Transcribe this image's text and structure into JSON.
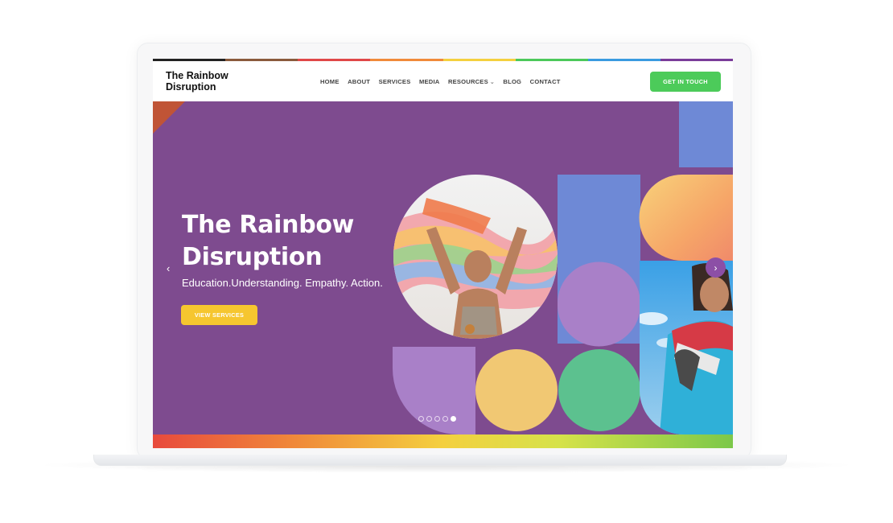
{
  "site": {
    "logo_line1": "The Rainbow",
    "logo_line2": "Disruption"
  },
  "nav": {
    "home": "HOME",
    "about": "ABOUT",
    "services": "SERVICES",
    "media": "MEDIA",
    "resources": "RESOURCES",
    "blog": "BLOG",
    "contact": "CONTACT",
    "cta": "GET IN TOUCH"
  },
  "hero": {
    "title_line1": "The Rainbow",
    "title_line2": "Disruption",
    "subtitle": "Education.Understanding. Empathy. Action.",
    "button": "VIEW SERVICES",
    "slide_count": 5,
    "active_slide": 5
  },
  "colors": {
    "purple": "#7e4b8f",
    "green_cta": "#4ccb5a",
    "yellow_btn": "#f6c62f",
    "stripe": [
      "#222222",
      "#8a5a3c",
      "#e04848",
      "#f08a3a",
      "#f4d03f",
      "#4cc85a",
      "#3a9be0",
      "#7a3c9a"
    ]
  },
  "icons": {
    "prev": "chevron-left-icon",
    "next": "chevron-right-icon",
    "dropdown": "chevron-down-icon"
  }
}
